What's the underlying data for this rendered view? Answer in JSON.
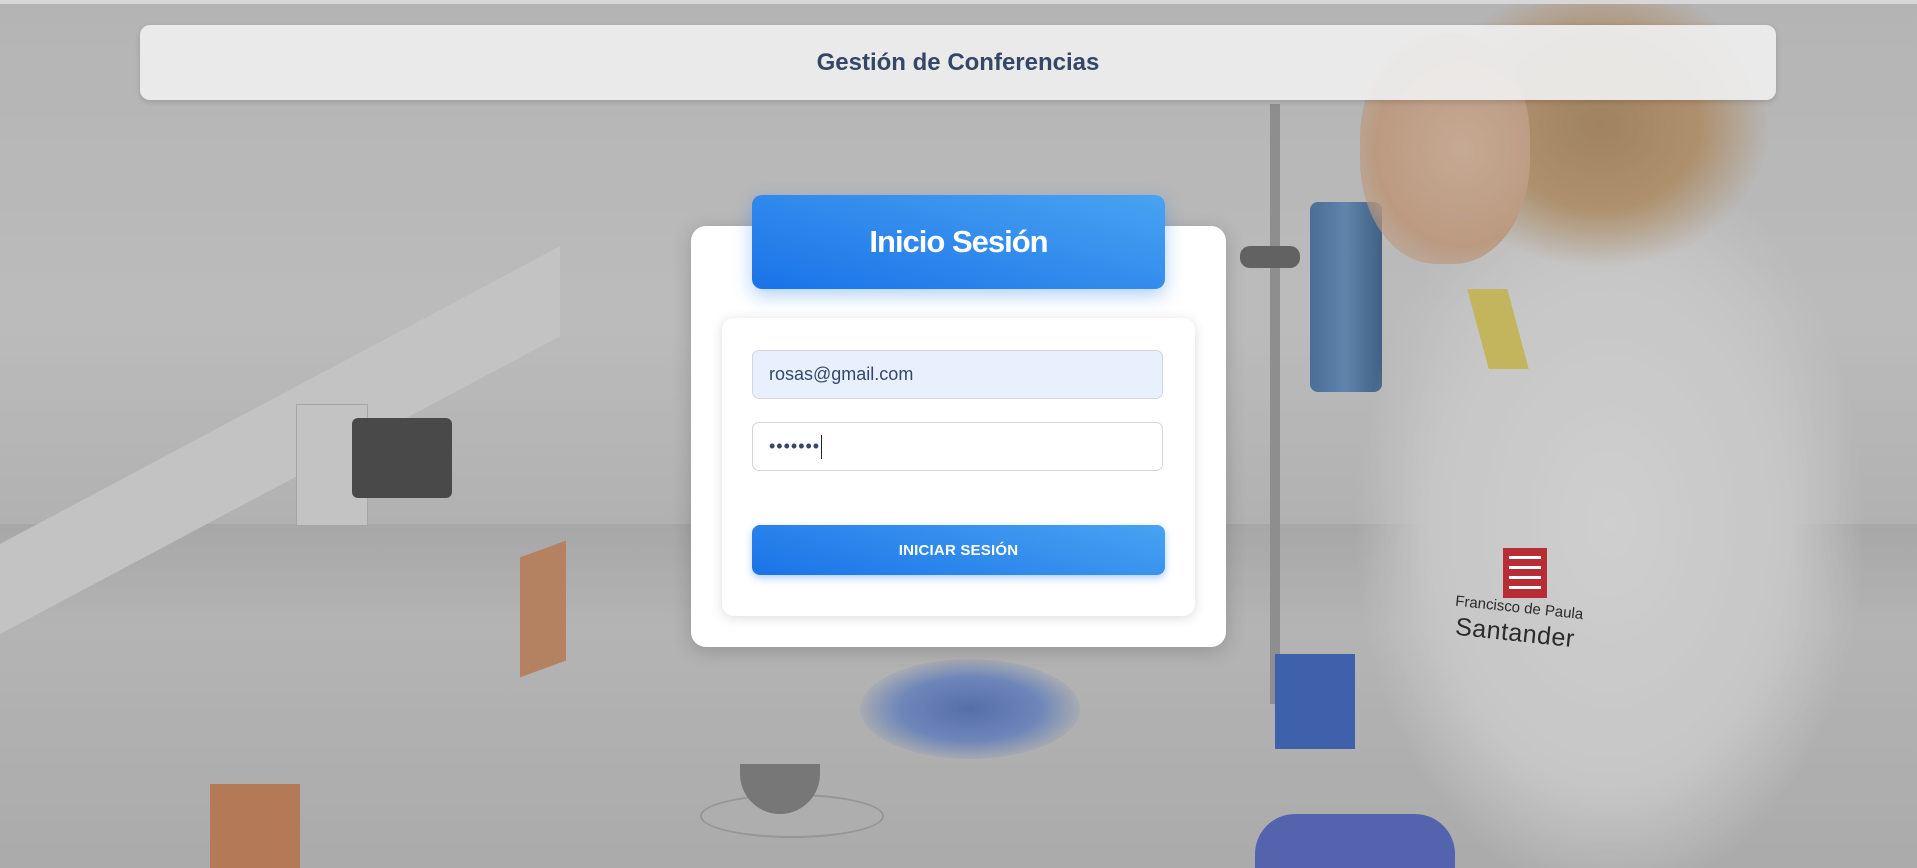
{
  "header": {
    "title": "Gestión de Conferencias"
  },
  "login": {
    "title": "Inicio Sesión",
    "email_value": "rosas@gmail.com",
    "password_value": "•••••••",
    "submit_label": "INICIAR SESIÓN"
  },
  "background": {
    "logo_line1": "Francisco de Paula",
    "logo_line2": "Santander",
    "logo_mark": "UFPS"
  },
  "colors": {
    "accent": "#1a73e8",
    "accent_light": "#49a3f1",
    "header_text": "#344767",
    "email_field_bg": "#e8f0fe",
    "logo_red": "#b82c36"
  },
  "icons": {
    "logo": "ufps-logo-icon"
  }
}
